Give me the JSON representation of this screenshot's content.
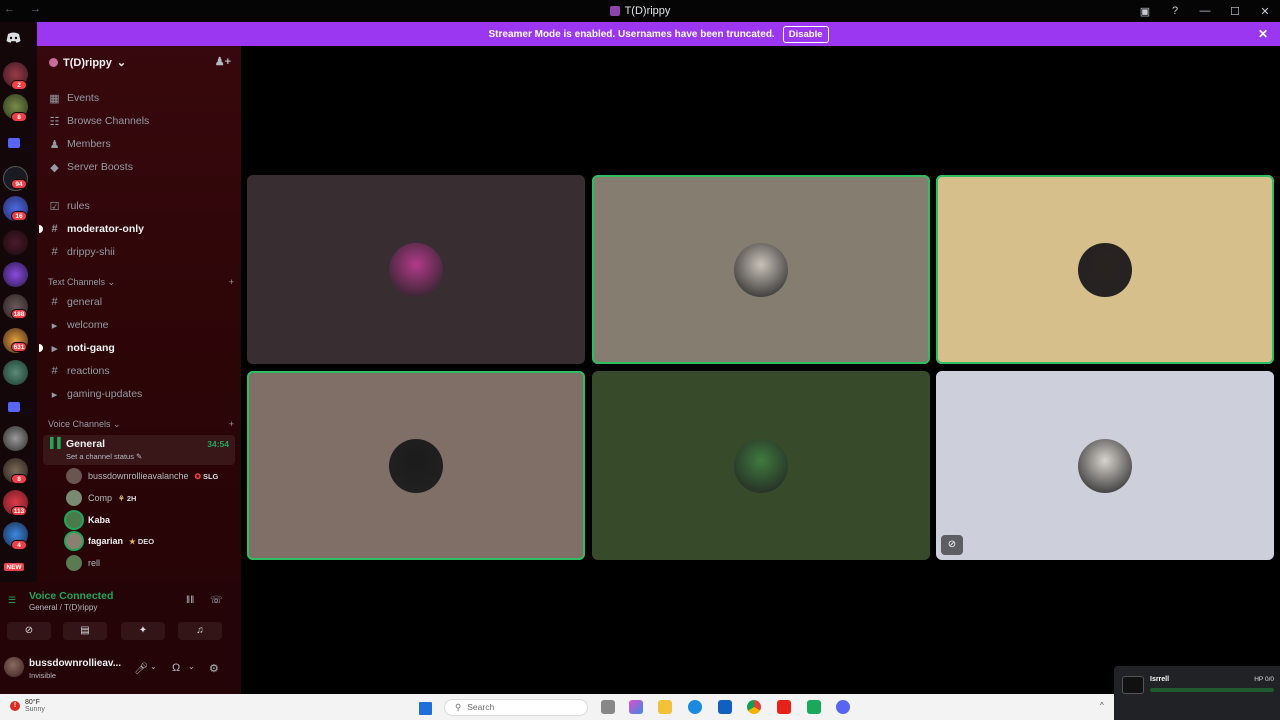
{
  "window": {
    "title": "T(D)rippy",
    "nav_icons": "← →",
    "controls": [
      "▣",
      "?",
      "—",
      "☐",
      "✕"
    ]
  },
  "banner": {
    "message": "Streamer Mode is enabled. Usernames have been truncated.",
    "disable_label": "Disable",
    "close": "✕"
  },
  "guilds": {
    "badges": [
      "2",
      "8",
      "94",
      "16",
      "188",
      "631",
      "8",
      "113",
      "4",
      "NEW"
    ],
    "home_icon": "discord-logo-icon"
  },
  "server": {
    "name": "T(D)rippy",
    "chevron": "⌄",
    "invite_icon": "add-member-icon",
    "nav": [
      {
        "label": "Events",
        "icon": "calendar-icon"
      },
      {
        "label": "Browse Channels",
        "icon": "browse-channels-icon"
      },
      {
        "label": "Members",
        "icon": "members-icon"
      },
      {
        "label": "Server Boosts",
        "icon": "boost-icon"
      }
    ],
    "top_channels": [
      {
        "label": "rules",
        "icon": "rules-icon",
        "bold": false
      },
      {
        "label": "moderator-only",
        "icon": "hashtag-icon",
        "bold": true
      },
      {
        "label": "drippy-shii",
        "icon": "hashtag-icon",
        "bold": false
      }
    ],
    "text_category": "Text Channels",
    "text_channels": [
      {
        "label": "general",
        "icon": "hashtag-icon",
        "bold": false
      },
      {
        "label": "welcome",
        "icon": "megaphone-icon",
        "bold": false
      },
      {
        "label": "noti-gang",
        "icon": "megaphone-icon",
        "bold": true
      },
      {
        "label": "reactions",
        "icon": "hashtag-icon",
        "bold": false
      },
      {
        "label": "gaming-updates",
        "icon": "megaphone-icon",
        "bold": false
      }
    ],
    "voice_category": "Voice Channels",
    "voice_channel": {
      "name": "General",
      "timer": "34:54",
      "status": "Set a channel status ✎"
    },
    "voice_users": [
      {
        "name": "bussdownrollieavalanche",
        "tag": "SLG",
        "tag_icon": "guild-tag-icon"
      },
      {
        "name": "Comp",
        "tag": "2H",
        "tag_icon": "guild-tag-icon"
      },
      {
        "name": "Kaba",
        "tag": ""
      },
      {
        "name": "fagarian",
        "tag": "DEO",
        "tag_icon": "guild-tag-icon"
      },
      {
        "name": "rell",
        "tag": ""
      }
    ]
  },
  "voice_panel": {
    "status": "Voice Connected",
    "location": "General / T(D)rippy"
  },
  "user_panel": {
    "username": "bussdownrollieav...",
    "status": "Invisible"
  },
  "tiles": [
    {
      "bg": "#382e31",
      "speaking": false,
      "avatar": "#b23a8a"
    },
    {
      "bg": "#857d70",
      "speaking": true,
      "avatar": "#c9c2b8"
    },
    {
      "bg": "#d6bf8a",
      "speaking": true,
      "avatar": "#2a2320"
    },
    {
      "bg": "#7f6f66",
      "speaking": true,
      "avatar": "#1b1b1b"
    },
    {
      "bg": "#374a29",
      "speaking": false,
      "avatar": "#3f7a3f"
    },
    {
      "bg": "#cdd0db",
      "speaking": false,
      "avatar": "#d8d4cf",
      "camera_off": true
    }
  ],
  "taskbar": {
    "temp": "80°F",
    "weather": "Sunny",
    "search_placeholder": "Search",
    "tray_chevron": "^"
  },
  "game_overlay": {
    "name": "Isrrell",
    "hp": "HP 0/0"
  }
}
